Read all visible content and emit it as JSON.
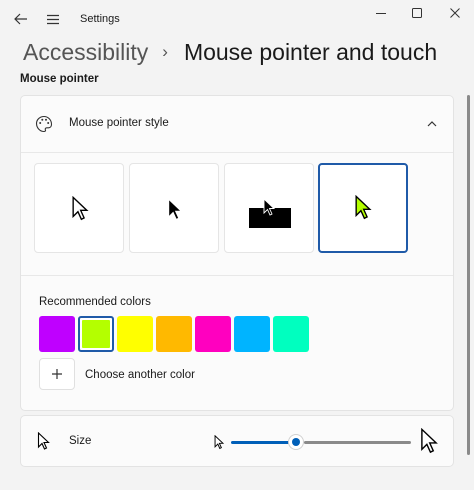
{
  "titlebar": {
    "app_title": "Settings"
  },
  "breadcrumb": {
    "parent": "Accessibility",
    "separator": "›",
    "current": "Mouse pointer and touch"
  },
  "section": {
    "label": "Mouse pointer"
  },
  "pointer_style": {
    "title": "Mouse pointer style",
    "expanded": true,
    "options": [
      {
        "kind": "white",
        "selected": false
      },
      {
        "kind": "black",
        "selected": false
      },
      {
        "kind": "inverted",
        "selected": false
      },
      {
        "kind": "custom",
        "selected": true
      }
    ],
    "recommended_label": "Recommended colors",
    "colors": [
      {
        "hex": "#bf00ff",
        "selected": false
      },
      {
        "hex": "#b4ff00",
        "selected": true
      },
      {
        "hex": "#ffff00",
        "selected": false
      },
      {
        "hex": "#ffb900",
        "selected": false
      },
      {
        "hex": "#ff00bf",
        "selected": false
      },
      {
        "hex": "#00b4ff",
        "selected": false
      },
      {
        "hex": "#00ffbf",
        "selected": false
      }
    ],
    "add_color_label": "Choose another color"
  },
  "size": {
    "label": "Size",
    "value_fraction": 0.36
  },
  "colors": {
    "accent": "#005fb8",
    "selected_border": "#1f5aa8",
    "custom_cursor_fill": "#b4ff00"
  }
}
